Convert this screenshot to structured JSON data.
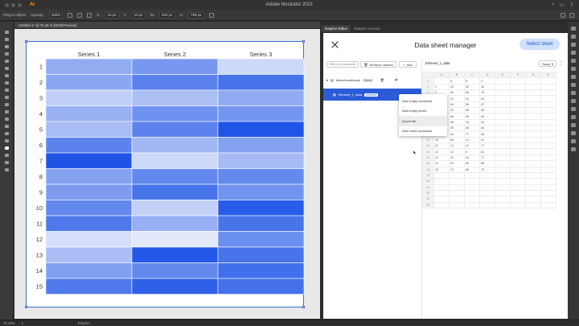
{
  "app": {
    "window_title": "Adobe Illustrator 2021",
    "logo": "Ai"
  },
  "control_bar": {
    "selection_label": "Plug-in Object",
    "opacity_label": "Opacity:",
    "opacity_value": "100%",
    "x_value": "16 px",
    "y_value": "10 px",
    "w_value": "403 px",
    "h_value": "759 px"
  },
  "document_tab": "Untitled-1* @ 75.49 % (RGB/Preview)",
  "status_bar": {
    "zoom": "75.49%",
    "artboard_index": "1",
    "tool_name": "Datylon"
  },
  "chart_data": {
    "type": "heatmap",
    "columns": [
      "Series 1",
      "Series 2",
      "Series 3"
    ],
    "rows": [
      "1",
      "2",
      "3",
      "4",
      "5",
      "6",
      "7",
      "8",
      "9",
      "10",
      "11",
      "12",
      "13",
      "14",
      "15"
    ],
    "values": [
      [
        43,
        55,
        16
      ],
      [
        46,
        69,
        78
      ],
      [
        22,
        31,
        44
      ],
      [
        40,
        59,
        57
      ],
      [
        33,
        68,
        96
      ],
      [
        68,
        36,
        49
      ],
      [
        96,
        16,
        34
      ],
      [
        49,
        65,
        64
      ],
      [
        53,
        77,
        58
      ],
      [
        65,
        21,
        91
      ],
      [
        74,
        41,
        77
      ],
      [
        12,
        6,
        61
      ],
      [
        32,
        94,
        77
      ],
      [
        51,
        65,
        80
      ],
      [
        74,
        89,
        79
      ]
    ],
    "color_low": "#e3e9fb",
    "color_high": "#1f55e6"
  },
  "panel": {
    "tabs": [
      "Datylon Editor",
      "Datylon Account"
    ]
  },
  "dialog": {
    "title": "Data sheet manager",
    "select_button": "Select sheet",
    "filter_placeholder": "Filter by sheetname",
    "remove_unused": "Remove unused",
    "add_label": "Add",
    "workbook_name": "default workbook",
    "workbook_chip": "Excel",
    "workbook_right_cut": "pl",
    "sheet_item": "Element_1_data",
    "selected_chip": "selected",
    "menu": [
      "Add empty workbook",
      "Add empty sheet",
      "Import file",
      "Add online workbook"
    ],
    "current_sheet": "Element_1_data",
    "swap_label": "Swap",
    "grid_cols": [
      "",
      "A",
      "B",
      "C",
      "D",
      "E",
      "F",
      "G",
      "H"
    ],
    "grid_rows": [
      [
        "",
        "A",
        "B",
        "C"
      ],
      [
        "1",
        "43",
        "55",
        "16"
      ],
      [
        "2",
        "46",
        "69",
        "78"
      ],
      [
        "3",
        "22",
        "31",
        "44"
      ],
      [
        "4",
        "40",
        "59",
        "57"
      ],
      [
        "5",
        "33",
        "68",
        "96"
      ],
      [
        "6",
        "68",
        "36",
        "49"
      ],
      [
        "7",
        "96",
        "16",
        "34"
      ],
      [
        "8",
        "49",
        "65",
        "64"
      ],
      [
        "9",
        "53",
        "77",
        "58"
      ],
      [
        "10",
        "65",
        "21",
        "91"
      ],
      [
        "11",
        "74",
        "41",
        "77"
      ],
      [
        "12",
        "12",
        "6",
        "61"
      ],
      [
        "13",
        "32",
        "94",
        "77"
      ],
      [
        "14",
        "51",
        "65",
        "80"
      ],
      [
        "15",
        "74",
        "89",
        "79"
      ]
    ],
    "total_rows": 22
  }
}
